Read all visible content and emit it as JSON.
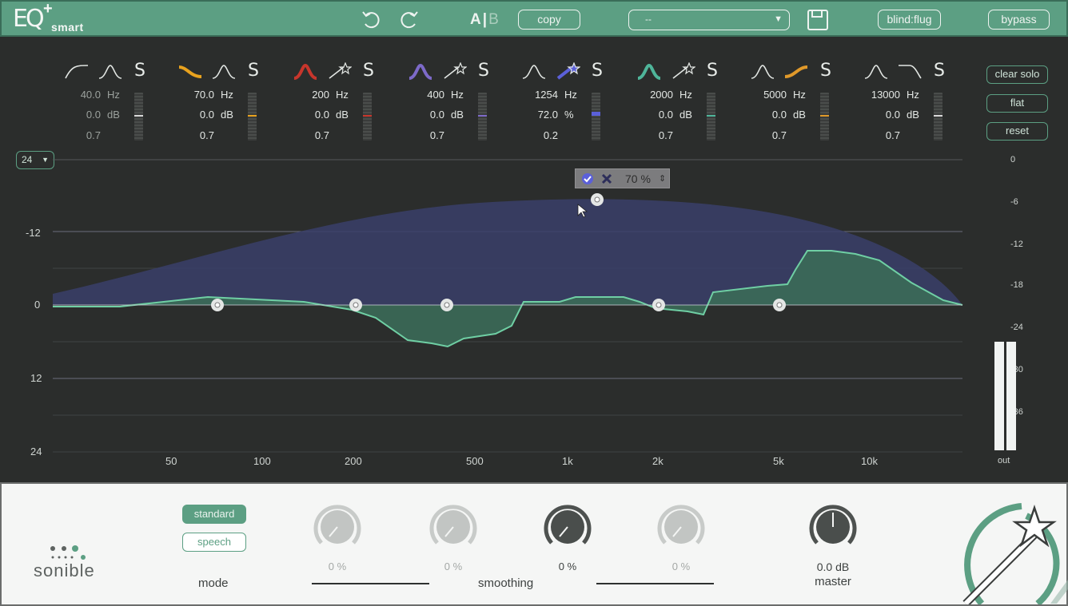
{
  "header": {
    "logo_text": "EQ",
    "logo_plus": "+",
    "logo_sub": "smart",
    "ab_a": "A",
    "ab_sep": "|",
    "ab_b": "B",
    "copy_label": "copy",
    "preset_value": "--",
    "blind_label": "blind:flug",
    "bypass_label": "bypass"
  },
  "bands": [
    {
      "id": "1",
      "freq": "40.0",
      "gain": "0.0",
      "q": "0.7",
      "freq_unit": "Hz",
      "gain_unit": "dB",
      "color": "#d8d8d8",
      "active": false,
      "left_shape": "high-cut",
      "right_shape": "bell"
    },
    {
      "id": "2",
      "freq": "70.0",
      "gain": "0.0",
      "q": "0.7",
      "freq_unit": "Hz",
      "gain_unit": "dB",
      "color": "#e8a21e",
      "active": true,
      "left_shape": "low-shelf",
      "right_shape": "bell"
    },
    {
      "id": "3",
      "freq": "200",
      "gain": "0.0",
      "q": "0.7",
      "freq_unit": "Hz",
      "gain_unit": "dB",
      "color": "#c8362c",
      "active": true,
      "left_shape": "bell",
      "right_shape": "magic-wand"
    },
    {
      "id": "4",
      "freq": "400",
      "gain": "0.0",
      "q": "0.7",
      "freq_unit": "Hz",
      "gain_unit": "dB",
      "color": "#7d6ac9",
      "active": true,
      "left_shape": "bell",
      "right_shape": "magic-wand"
    },
    {
      "id": "5",
      "freq": "1254",
      "gain": "72.0",
      "q": "0.2",
      "freq_unit": "Hz",
      "gain_unit": "%",
      "color": "#5b60d9",
      "active": true,
      "left_shape": "bell",
      "right_shape": "magic-wand"
    },
    {
      "id": "6",
      "freq": "2000",
      "gain": "0.0",
      "q": "0.7",
      "freq_unit": "Hz",
      "gain_unit": "dB",
      "color": "#4fb59a",
      "active": true,
      "left_shape": "bell",
      "right_shape": "magic-wand"
    },
    {
      "id": "7",
      "freq": "5000",
      "gain": "0.0",
      "q": "0.7",
      "freq_unit": "Hz",
      "gain_unit": "dB",
      "color": "#e0992a",
      "active": true,
      "left_shape": "bell",
      "right_shape": "high-shelf"
    },
    {
      "id": "8",
      "freq": "13000",
      "gain": "0.0",
      "q": "0.7",
      "freq_unit": "Hz",
      "gain_unit": "dB",
      "color": "#d8d8d8",
      "active": true,
      "left_shape": "bell",
      "right_shape": "low-cut"
    }
  ],
  "band_solo_label": "S",
  "side": {
    "clear_solo": "clear solo",
    "flat": "flat",
    "reset": "reset"
  },
  "graph": {
    "range_value": "24",
    "left_axis": [
      "-12",
      "0",
      "12",
      "24"
    ],
    "right_axis": [
      "0",
      "-6",
      "-12",
      "-18",
      "-24",
      "-30",
      "-36"
    ],
    "freq_axis": [
      "50",
      "100",
      "200",
      "500",
      "1k",
      "2k",
      "5k",
      "10k"
    ],
    "out_label": "out",
    "tooltip_value": "70 %",
    "tooltip_arrows": "⇕"
  },
  "bottom": {
    "brand": "sonible",
    "mode_standard": "standard",
    "mode_speech": "speech",
    "mode_label": "mode",
    "knob_values": [
      "0 %",
      "0 %",
      "0 %",
      "0 %"
    ],
    "smoothing_label": "smoothing",
    "master_value": "0.0 dB",
    "master_label": "master"
  },
  "colors": {
    "accent": "#5c9f83",
    "background": "#2b2d2c",
    "eq_fill": "#3b6a58",
    "eq_line": "#6fcfa4",
    "profile_fill": "#3a3f6a"
  }
}
